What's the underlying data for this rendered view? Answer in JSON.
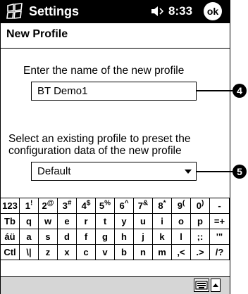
{
  "titlebar": {
    "app_title": "Settings",
    "time": "8:33",
    "ok_label": "ok",
    "start_icon": "windows-flag-icon",
    "volume_icon": "speaker-icon"
  },
  "heading": "New Profile",
  "name_section": {
    "label": "Enter the name of the new profile",
    "value": "BT Demo1"
  },
  "preset_section": {
    "label_line1": "Select an existing profile to preset the",
    "label_line2": "configuration data of the new profile",
    "selected": "Default"
  },
  "callouts": [
    "4",
    "5"
  ],
  "keyboard": {
    "row1": [
      {
        "main": "123",
        "sup": ""
      },
      {
        "main": "1",
        "sup": "!"
      },
      {
        "main": "2",
        "sup": "@"
      },
      {
        "main": "3",
        "sup": "#"
      },
      {
        "main": "4",
        "sup": "$"
      },
      {
        "main": "5",
        "sup": "%"
      },
      {
        "main": "6",
        "sup": "^"
      },
      {
        "main": "7",
        "sup": "&"
      },
      {
        "main": "8",
        "sup": "*"
      },
      {
        "main": "9",
        "sup": "("
      },
      {
        "main": "0",
        "sup": ")"
      },
      {
        "main": "-",
        "sup": ""
      }
    ],
    "row2": [
      "Tb",
      "q",
      "w",
      "e",
      "r",
      "t",
      "y",
      "u",
      "i",
      "o",
      "p",
      "=+"
    ],
    "row3": [
      "áü",
      "a",
      "s",
      "d",
      "f",
      "g",
      "h",
      "j",
      "k",
      "l",
      ";:",
      "'\""
    ],
    "row4": [
      "Ctl",
      "\\|",
      "z",
      "x",
      "c",
      "v",
      "b",
      "n",
      "m",
      ",<",
      ".>",
      "/?"
    ]
  }
}
